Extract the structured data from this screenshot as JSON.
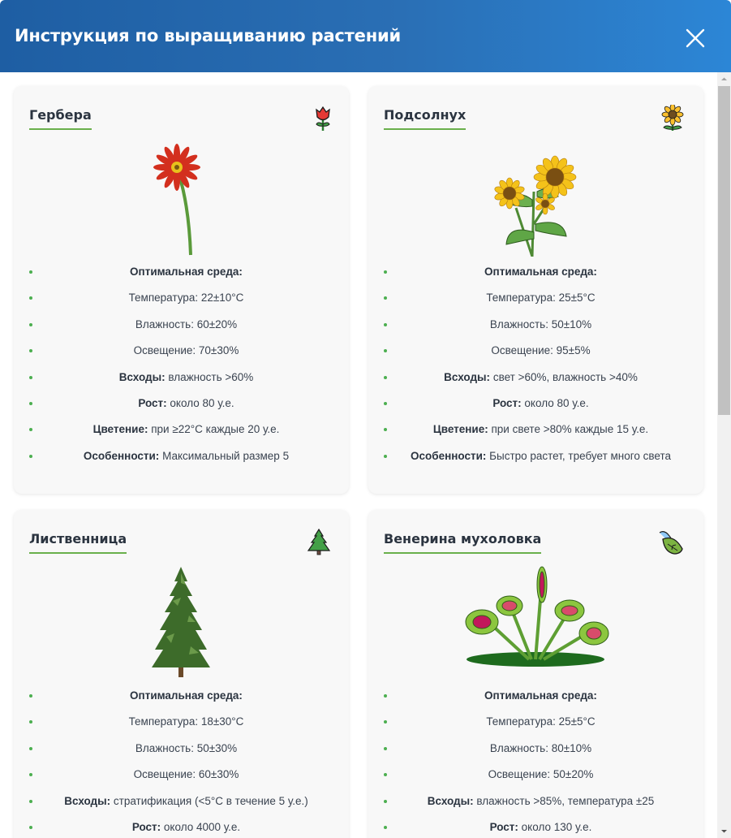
{
  "header": {
    "title": "Инструкция по выращиванию растений"
  },
  "cards": [
    {
      "name": "Гербера",
      "icon": "rose-icon",
      "env_heading": "Оптимальная среда:",
      "temperature": "Температура: 22±10°C",
      "humidity": "Влажность: 60±20%",
      "light": "Освещение: 70±30%",
      "sprouts_label": "Всходы:",
      "sprouts_value": " влажность >60%",
      "growth_label": "Рост:",
      "growth_value": " около 80 у.е.",
      "bloom_label": "Цветение:",
      "bloom_value": " при ≥22°C каждые 20 у.е.",
      "features_label": "Особенности:",
      "features_value": " Максимальный размер 5"
    },
    {
      "name": "Подсолнух",
      "icon": "sunflower-icon",
      "env_heading": "Оптимальная среда:",
      "temperature": "Температура: 25±5°C",
      "humidity": "Влажность: 50±10%",
      "light": "Освещение: 95±5%",
      "sprouts_label": "Всходы:",
      "sprouts_value": " свет >60%, влажность >40%",
      "growth_label": "Рост:",
      "growth_value": " около 80 у.е.",
      "bloom_label": "Цветение:",
      "bloom_value": " при свете >80% каждые 15 у.е.",
      "features_label": "Особенности:",
      "features_value": " Быстро растет, требует много света"
    },
    {
      "name": "Лиственница",
      "icon": "evergreen-tree-icon",
      "env_heading": "Оптимальная среда:",
      "temperature": "Температура: 18±30°C",
      "humidity": "Влажность: 50±30%",
      "light": "Освещение: 60±30%",
      "sprouts_label": "Всходы:",
      "sprouts_value": " стратификация (<5°C в течение 5 у.е.)",
      "growth_label": "Рост:",
      "growth_value": " около 4000 у.е."
    },
    {
      "name": "Венерина мухоловка",
      "icon": "leaf-icon",
      "env_heading": "Оптимальная среда:",
      "temperature": "Температура: 25±5°C",
      "humidity": "Влажность: 80±10%",
      "light": "Освещение: 50±20%",
      "sprouts_label": "Всходы:",
      "sprouts_value": " влажность >85%, температура ±25",
      "growth_label": "Рост:",
      "growth_value": " около 130 у.е."
    }
  ]
}
